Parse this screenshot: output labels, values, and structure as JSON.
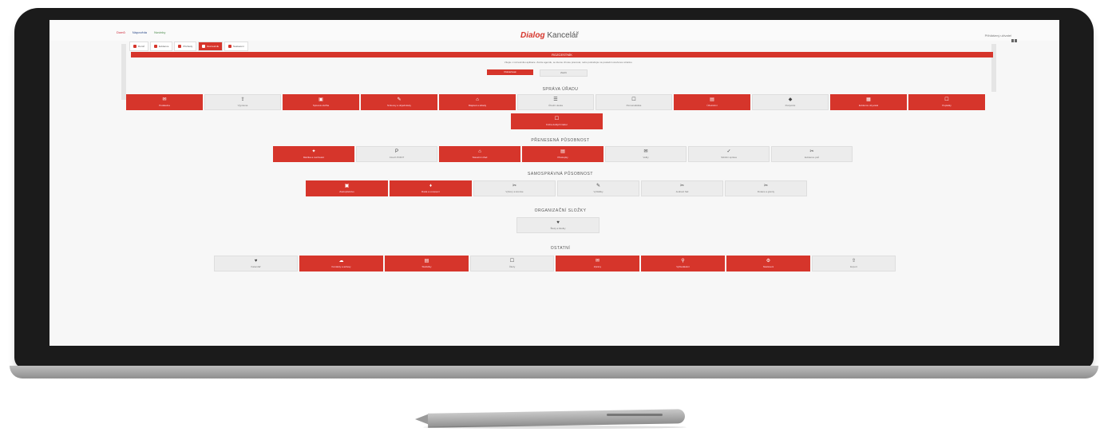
{
  "header": {
    "links": [
      "Domů",
      "Nápověda",
      "Novinky"
    ],
    "app_brand": "Dialog",
    "app_title": "Kancelář",
    "user": "Přihlášený uživatel"
  },
  "tabs": [
    {
      "label": "Domů",
      "active": false
    },
    {
      "label": "Evidence",
      "active": false
    },
    {
      "label": "Přehledy",
      "active": false
    },
    {
      "label": "Rozcestník",
      "active": true
    },
    {
      "label": "Nastavení",
      "active": false
    }
  ],
  "section_band": "ROZCESTNÍK",
  "notice": {
    "text": "Vítejte v rozcestníku aplikace. Zvolte agendu, se kterou chcete pracovat, nebo pokračujte na poslední otevřenou stránku.",
    "primary_button": "Pokračovat",
    "secondary_button": "Zavřít"
  },
  "groups": [
    {
      "title": "SPRÁVA ÚŘADU",
      "rows": [
        [
          {
            "label": "Podatelna",
            "icon": "✉",
            "style": "red"
          },
          {
            "label": "Výpravna",
            "icon": "⇪",
            "style": "gray"
          },
          {
            "label": "Spisová služba",
            "icon": "▣",
            "style": "red"
          },
          {
            "label": "Smlouvy a objednávky",
            "icon": "✎",
            "style": "red"
          },
          {
            "label": "Majetek a sklady",
            "icon": "⌂",
            "style": "red"
          },
          {
            "label": "Úřední deska",
            "icon": "☰",
            "style": "gray"
          },
          {
            "label": "Personalistika",
            "icon": "☐",
            "style": "gray"
          },
          {
            "label": "Účetnictví",
            "icon": "▤",
            "style": "red"
          },
          {
            "label": "Rozpočet",
            "icon": "◆",
            "style": "gray"
          },
          {
            "label": "Evidence obyvatel",
            "icon": "▦",
            "style": "red"
          },
          {
            "label": "Poplatky",
            "icon": "☐",
            "style": "red"
          }
        ],
        [
          {
            "label": "Kniha došlých faktur",
            "icon": "☐",
            "style": "red"
          }
        ]
      ]
    },
    {
      "title": "PŘENESENÁ PŮSOBNOST",
      "rows": [
        [
          {
            "label": "Matrika a ověřování",
            "icon": "✦",
            "style": "red"
          },
          {
            "label": "Czech POINT",
            "icon": "P",
            "style": "gray"
          },
          {
            "label": "Stavební úřad",
            "icon": "⌂",
            "style": "red"
          },
          {
            "label": "Přestupky",
            "icon": "▤",
            "style": "red"
          },
          {
            "label": "Volby",
            "icon": "✉",
            "style": "gray"
          },
          {
            "label": "Silniční správa",
            "icon": "✓",
            "style": "gray"
          },
          {
            "label": "Evidence psů",
            "icon": "✂",
            "style": "gray"
          }
        ]
      ]
    },
    {
      "title": "SAMOSPRÁVNÁ PŮSOBNOST",
      "rows": [
        [
          {
            "label": "Zastupitelstvo",
            "icon": "▣",
            "style": "red"
          },
          {
            "label": "Rada a usnesení",
            "icon": "♦",
            "style": "red"
          },
          {
            "label": "Výbory a komise",
            "icon": "✂",
            "style": "gray"
          },
          {
            "label": "Vyhlášky",
            "icon": "✎",
            "style": "gray"
          },
          {
            "label": "Jednací řád",
            "icon": "✂",
            "style": "gray"
          },
          {
            "label": "Dotace a granty",
            "icon": "✂",
            "style": "gray"
          }
        ]
      ]
    },
    {
      "title": "ORGANIZAČNÍ SLOŽKY",
      "rows": [
        [
          {
            "label": "Školy a školky",
            "icon": "♥",
            "style": "gray"
          }
        ]
      ]
    },
    {
      "title": "OSTATNÍ",
      "rows": [
        [
          {
            "label": "Kalendář",
            "icon": "♥",
            "style": "gray"
          },
          {
            "label": "Kontakty a adresy",
            "icon": "☁",
            "style": "red"
          },
          {
            "label": "Statistiky",
            "icon": "▤",
            "style": "red"
          },
          {
            "label": "Úkoly",
            "icon": "☐",
            "style": "gray"
          },
          {
            "label": "Zprávy",
            "icon": "✉",
            "style": "red"
          },
          {
            "label": "Vyhledávání",
            "icon": "⚲",
            "style": "red"
          },
          {
            "label": "Nastavení",
            "icon": "⚙",
            "style": "red"
          },
          {
            "label": "Export",
            "icon": "⇧",
            "style": "gray"
          }
        ]
      ]
    }
  ]
}
